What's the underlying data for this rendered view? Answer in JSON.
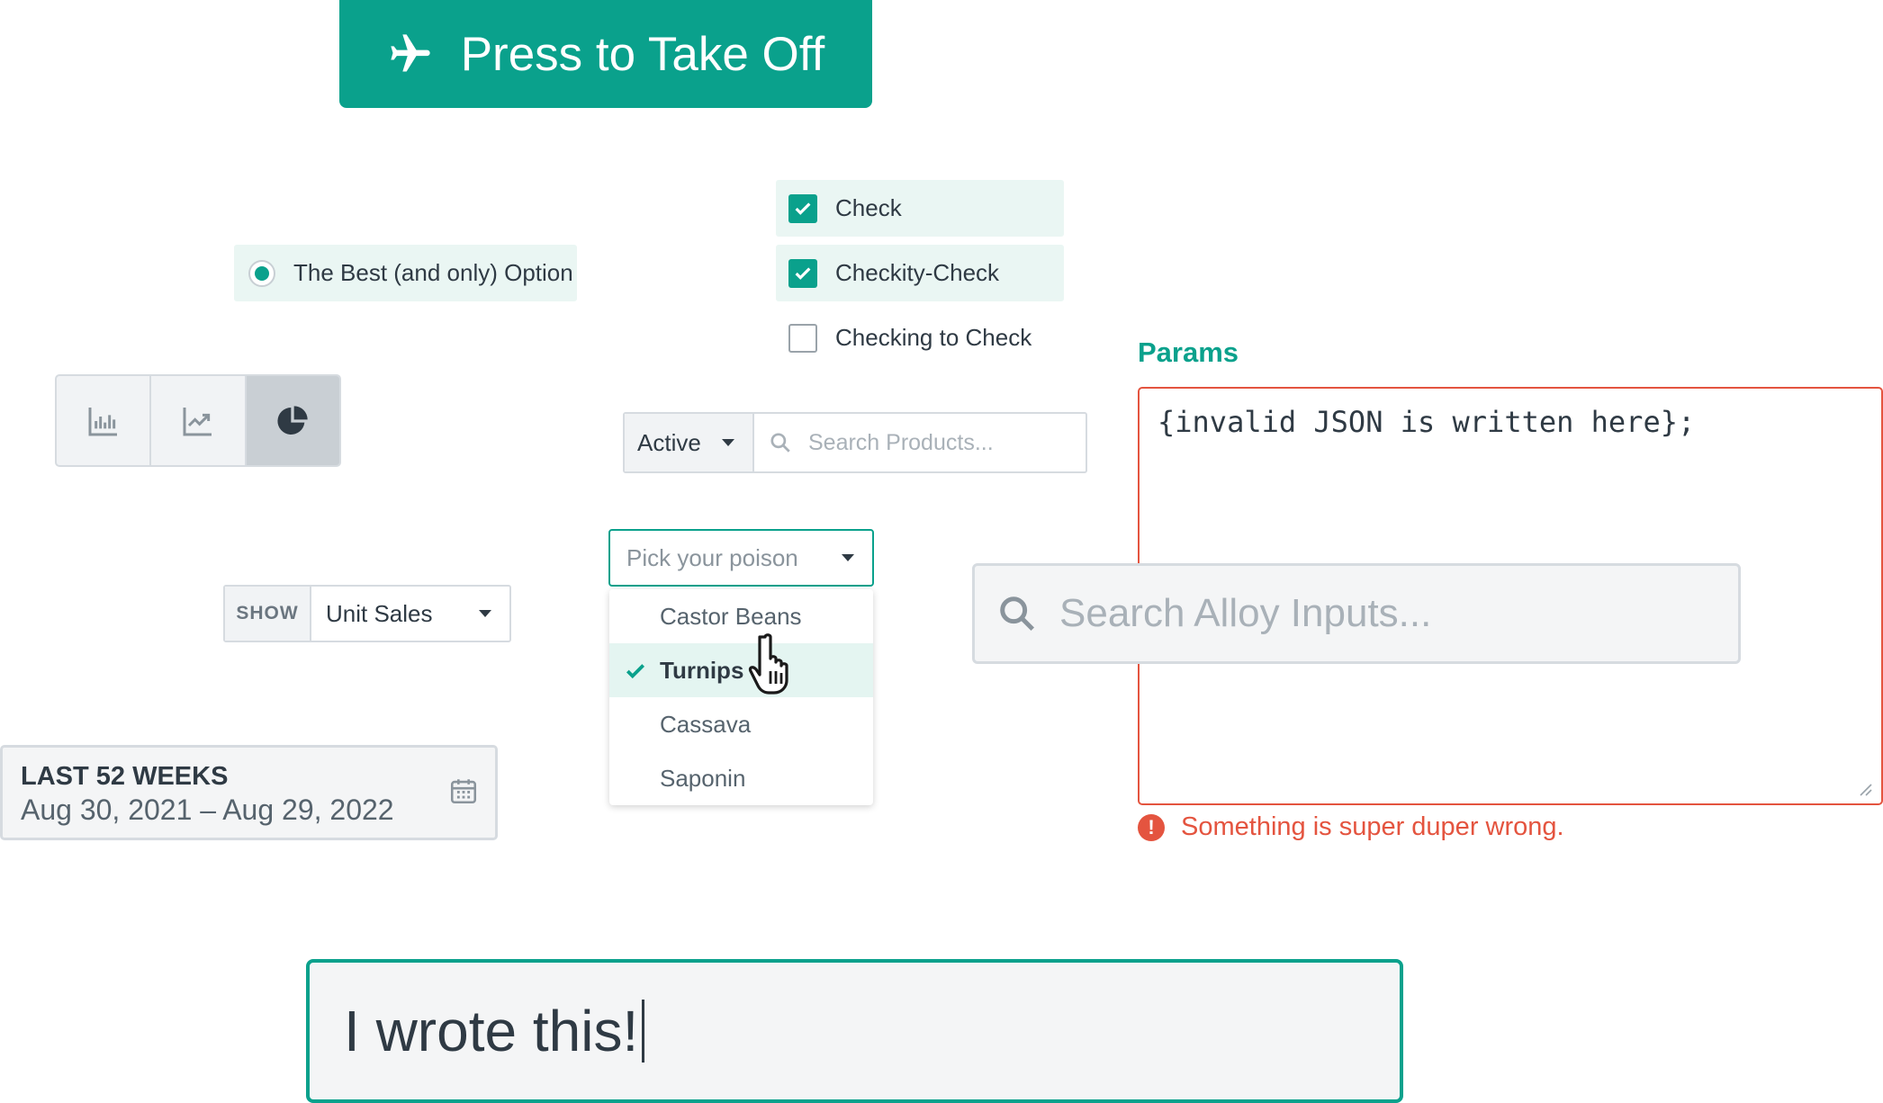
{
  "takeoff": {
    "label": "Press to Take Off",
    "icon": "airplane-icon"
  },
  "radio": {
    "label": "The Best (and only) Option",
    "selected": true
  },
  "checks": [
    {
      "label": "Check",
      "checked": true
    },
    {
      "label": "Checkity-Check",
      "checked": true
    },
    {
      "label": "Checking to Check",
      "checked": false
    }
  ],
  "chart_toggle": {
    "options": [
      "bar-chart-icon",
      "line-chart-icon",
      "pie-chart-icon"
    ],
    "selected": "pie-chart-icon"
  },
  "params": {
    "label": "Params",
    "value": "{invalid JSON is written here};",
    "error": "Something is super duper wrong."
  },
  "status_filter": {
    "value": "Active",
    "search_placeholder": "Search Products..."
  },
  "poison": {
    "placeholder": "Pick your poison",
    "options": [
      "Castor Beans",
      "Turnips",
      "Cassava",
      "Saponin"
    ],
    "selected": "Turnips"
  },
  "show": {
    "tag": "SHOW",
    "value": "Unit Sales"
  },
  "big_search": {
    "placeholder": "Search Alloy Inputs..."
  },
  "date": {
    "title": "LAST 52 WEEKS",
    "range": "Aug 30, 2021 – Aug 29, 2022"
  },
  "text_input": {
    "value": "I wrote this!"
  },
  "colors": {
    "accent": "#0aa18c",
    "error": "#e4543f",
    "text": "#2f3a44"
  }
}
